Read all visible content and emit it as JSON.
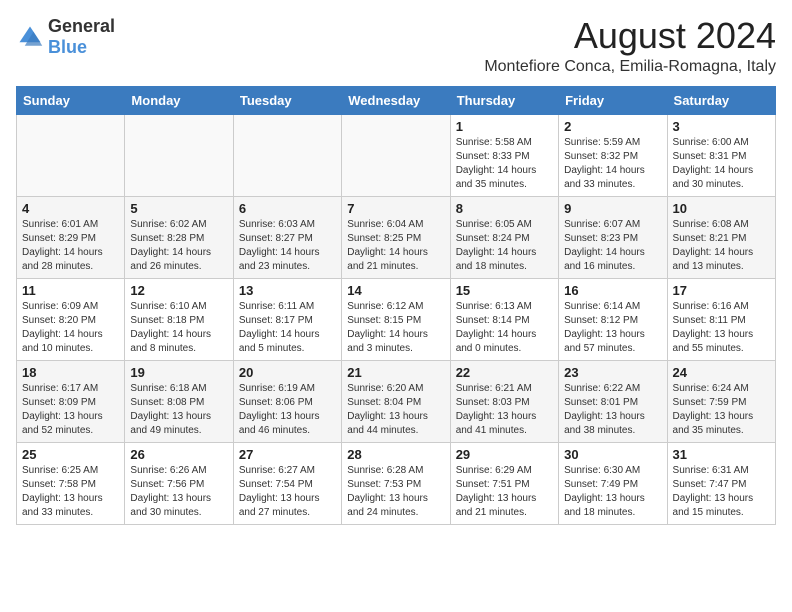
{
  "logo": {
    "text1": "General",
    "text2": "Blue"
  },
  "title": "August 2024",
  "subtitle": "Montefiore Conca, Emilia-Romagna, Italy",
  "headers": [
    "Sunday",
    "Monday",
    "Tuesday",
    "Wednesday",
    "Thursday",
    "Friday",
    "Saturday"
  ],
  "weeks": [
    [
      {
        "day": "",
        "info": ""
      },
      {
        "day": "",
        "info": ""
      },
      {
        "day": "",
        "info": ""
      },
      {
        "day": "",
        "info": ""
      },
      {
        "day": "1",
        "info": "Sunrise: 5:58 AM\nSunset: 8:33 PM\nDaylight: 14 hours\nand 35 minutes."
      },
      {
        "day": "2",
        "info": "Sunrise: 5:59 AM\nSunset: 8:32 PM\nDaylight: 14 hours\nand 33 minutes."
      },
      {
        "day": "3",
        "info": "Sunrise: 6:00 AM\nSunset: 8:31 PM\nDaylight: 14 hours\nand 30 minutes."
      }
    ],
    [
      {
        "day": "4",
        "info": "Sunrise: 6:01 AM\nSunset: 8:29 PM\nDaylight: 14 hours\nand 28 minutes."
      },
      {
        "day": "5",
        "info": "Sunrise: 6:02 AM\nSunset: 8:28 PM\nDaylight: 14 hours\nand 26 minutes."
      },
      {
        "day": "6",
        "info": "Sunrise: 6:03 AM\nSunset: 8:27 PM\nDaylight: 14 hours\nand 23 minutes."
      },
      {
        "day": "7",
        "info": "Sunrise: 6:04 AM\nSunset: 8:25 PM\nDaylight: 14 hours\nand 21 minutes."
      },
      {
        "day": "8",
        "info": "Sunrise: 6:05 AM\nSunset: 8:24 PM\nDaylight: 14 hours\nand 18 minutes."
      },
      {
        "day": "9",
        "info": "Sunrise: 6:07 AM\nSunset: 8:23 PM\nDaylight: 14 hours\nand 16 minutes."
      },
      {
        "day": "10",
        "info": "Sunrise: 6:08 AM\nSunset: 8:21 PM\nDaylight: 14 hours\nand 13 minutes."
      }
    ],
    [
      {
        "day": "11",
        "info": "Sunrise: 6:09 AM\nSunset: 8:20 PM\nDaylight: 14 hours\nand 10 minutes."
      },
      {
        "day": "12",
        "info": "Sunrise: 6:10 AM\nSunset: 8:18 PM\nDaylight: 14 hours\nand 8 minutes."
      },
      {
        "day": "13",
        "info": "Sunrise: 6:11 AM\nSunset: 8:17 PM\nDaylight: 14 hours\nand 5 minutes."
      },
      {
        "day": "14",
        "info": "Sunrise: 6:12 AM\nSunset: 8:15 PM\nDaylight: 14 hours\nand 3 minutes."
      },
      {
        "day": "15",
        "info": "Sunrise: 6:13 AM\nSunset: 8:14 PM\nDaylight: 14 hours\nand 0 minutes."
      },
      {
        "day": "16",
        "info": "Sunrise: 6:14 AM\nSunset: 8:12 PM\nDaylight: 13 hours\nand 57 minutes."
      },
      {
        "day": "17",
        "info": "Sunrise: 6:16 AM\nSunset: 8:11 PM\nDaylight: 13 hours\nand 55 minutes."
      }
    ],
    [
      {
        "day": "18",
        "info": "Sunrise: 6:17 AM\nSunset: 8:09 PM\nDaylight: 13 hours\nand 52 minutes."
      },
      {
        "day": "19",
        "info": "Sunrise: 6:18 AM\nSunset: 8:08 PM\nDaylight: 13 hours\nand 49 minutes."
      },
      {
        "day": "20",
        "info": "Sunrise: 6:19 AM\nSunset: 8:06 PM\nDaylight: 13 hours\nand 46 minutes."
      },
      {
        "day": "21",
        "info": "Sunrise: 6:20 AM\nSunset: 8:04 PM\nDaylight: 13 hours\nand 44 minutes."
      },
      {
        "day": "22",
        "info": "Sunrise: 6:21 AM\nSunset: 8:03 PM\nDaylight: 13 hours\nand 41 minutes."
      },
      {
        "day": "23",
        "info": "Sunrise: 6:22 AM\nSunset: 8:01 PM\nDaylight: 13 hours\nand 38 minutes."
      },
      {
        "day": "24",
        "info": "Sunrise: 6:24 AM\nSunset: 7:59 PM\nDaylight: 13 hours\nand 35 minutes."
      }
    ],
    [
      {
        "day": "25",
        "info": "Sunrise: 6:25 AM\nSunset: 7:58 PM\nDaylight: 13 hours\nand 33 minutes."
      },
      {
        "day": "26",
        "info": "Sunrise: 6:26 AM\nSunset: 7:56 PM\nDaylight: 13 hours\nand 30 minutes."
      },
      {
        "day": "27",
        "info": "Sunrise: 6:27 AM\nSunset: 7:54 PM\nDaylight: 13 hours\nand 27 minutes."
      },
      {
        "day": "28",
        "info": "Sunrise: 6:28 AM\nSunset: 7:53 PM\nDaylight: 13 hours\nand 24 minutes."
      },
      {
        "day": "29",
        "info": "Sunrise: 6:29 AM\nSunset: 7:51 PM\nDaylight: 13 hours\nand 21 minutes."
      },
      {
        "day": "30",
        "info": "Sunrise: 6:30 AM\nSunset: 7:49 PM\nDaylight: 13 hours\nand 18 minutes."
      },
      {
        "day": "31",
        "info": "Sunrise: 6:31 AM\nSunset: 7:47 PM\nDaylight: 13 hours\nand 15 minutes."
      }
    ]
  ]
}
